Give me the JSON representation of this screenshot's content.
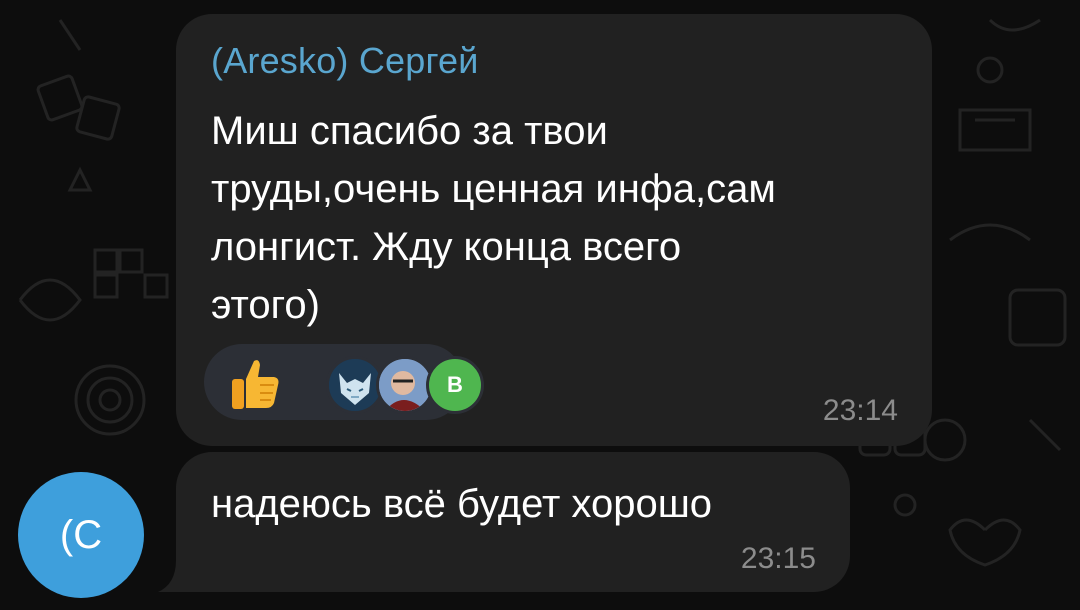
{
  "colors": {
    "background": "#0d0d0d",
    "bubble": "#212121",
    "sender_name": "#5aa6cf",
    "timestamp": "#8c8c8c",
    "reaction_pill": "#2c2f36",
    "avatar_c": "#3e9fdc",
    "avatar_b": "#4fb64f"
  },
  "messages": [
    {
      "sender": "(Aresko) Сергей",
      "text": "Миш спасибо за твои\nтруды,очень ценная инфа,сам\nлонгист. Жду конца всего\nэтого)",
      "time": "23:14",
      "reactions": {
        "emoji_icon": "thumbs-up-icon",
        "reactor_avatar_label": "B"
      }
    },
    {
      "text": "надеюсь всё будет хорошо",
      "time": "23:15"
    }
  ],
  "sender_avatar": {
    "initials": "(C"
  }
}
